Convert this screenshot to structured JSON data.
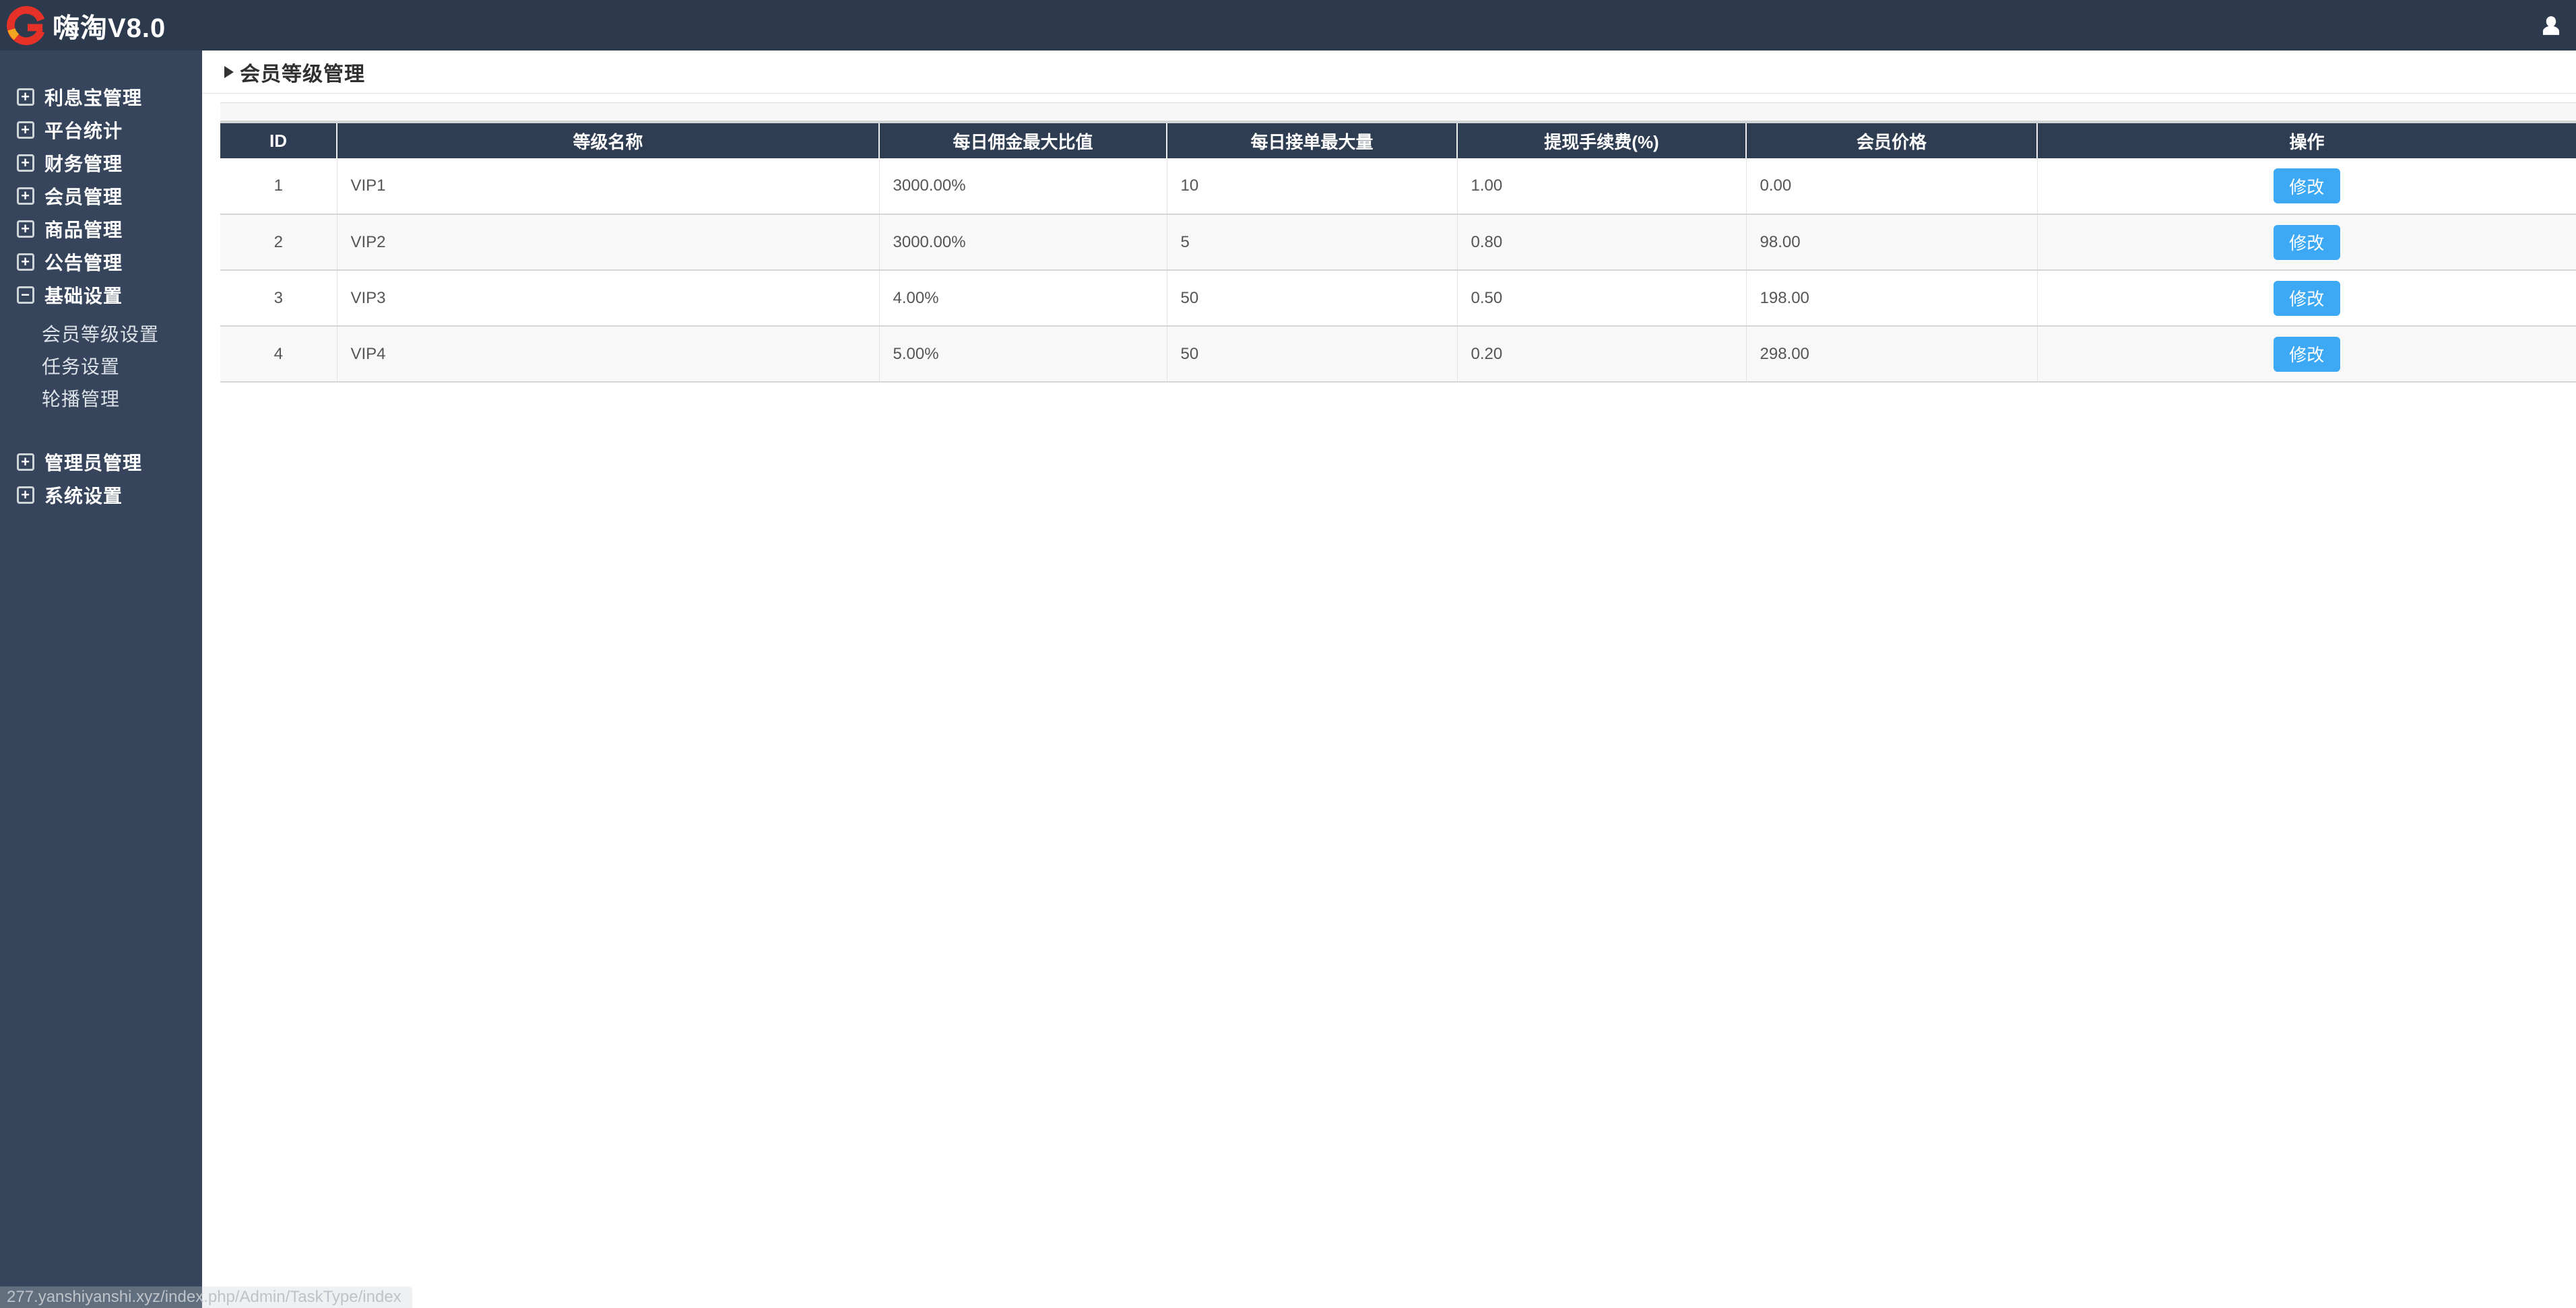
{
  "topbar": {
    "logo_text": "嗨淘V8.0"
  },
  "sidebar": {
    "items": [
      {
        "label": "利息宝管理",
        "toggle": "+"
      },
      {
        "label": "平台统计",
        "toggle": "+"
      },
      {
        "label": "财务管理",
        "toggle": "+"
      },
      {
        "label": "会员管理",
        "toggle": "+"
      },
      {
        "label": "商品管理",
        "toggle": "+"
      },
      {
        "label": "公告管理",
        "toggle": "+"
      },
      {
        "label": "基础设置",
        "toggle": "−",
        "expanded": true,
        "children": [
          {
            "label": "会员等级设置"
          },
          {
            "label": "任务设置"
          },
          {
            "label": "轮播管理"
          }
        ]
      },
      {
        "label": "管理员管理",
        "toggle": "+"
      },
      {
        "label": "系统设置",
        "toggle": "+"
      }
    ]
  },
  "page": {
    "title": "会员等级管理"
  },
  "table": {
    "columns": [
      "ID",
      "等级名称",
      "每日佣金最大比值",
      "每日接单最大量",
      "提现手续费(%)",
      "会员价格",
      "操作"
    ],
    "edit_label": "修改",
    "rows": [
      {
        "id": "1",
        "name": "VIP1",
        "commission": "3000.00%",
        "max_orders": "10",
        "withdraw_fee": "1.00",
        "price": "0.00"
      },
      {
        "id": "2",
        "name": "VIP2",
        "commission": "3000.00%",
        "max_orders": "5",
        "withdraw_fee": "0.80",
        "price": "98.00"
      },
      {
        "id": "3",
        "name": "VIP3",
        "commission": "4.00%",
        "max_orders": "50",
        "withdraw_fee": "0.50",
        "price": "198.00"
      },
      {
        "id": "4",
        "name": "VIP4",
        "commission": "5.00%",
        "max_orders": "50",
        "withdraw_fee": "0.20",
        "price": "298.00"
      }
    ]
  },
  "statusbar": {
    "url": "277.yanshiyanshi.xyz/index.php/Admin/TaskType/index"
  },
  "colors": {
    "topbar_bg": "#2d3a4d",
    "sidebar_bg": "#36455b",
    "table_header_bg": "#2f3d52",
    "accent_blue": "#3da9f4",
    "logo_red": "#e63128",
    "logo_orange": "#f2a51f"
  }
}
